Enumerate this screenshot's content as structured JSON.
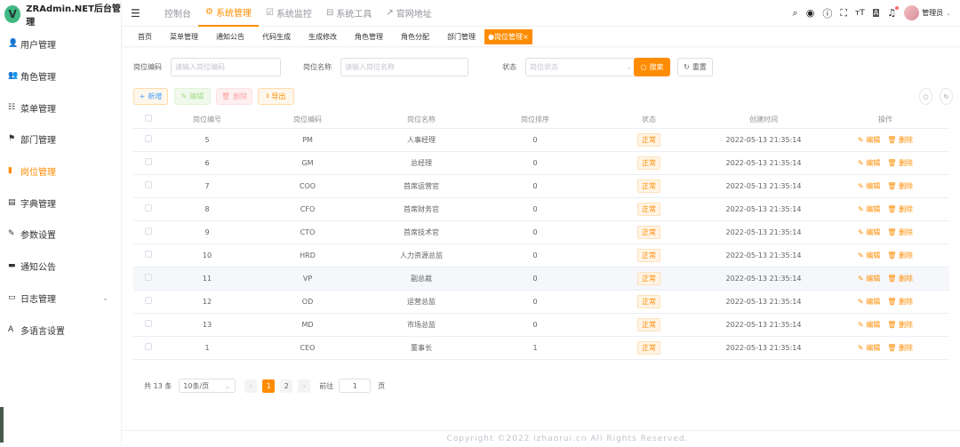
{
  "app": {
    "logo_letter": "V",
    "title": "ZRAdmin.NET后台管理"
  },
  "sidebar": {
    "items": [
      {
        "label": "用户管理",
        "icon": "user-icon"
      },
      {
        "label": "角色管理",
        "icon": "role-icon"
      },
      {
        "label": "菜单管理",
        "icon": "menu-icon"
      },
      {
        "label": "部门管理",
        "icon": "tree-icon"
      },
      {
        "label": "岗位管理",
        "icon": "post-icon",
        "active": true
      },
      {
        "label": "字典管理",
        "icon": "dict-icon"
      },
      {
        "label": "参数设置",
        "icon": "edit-icon"
      },
      {
        "label": "通知公告",
        "icon": "message-icon"
      },
      {
        "label": "日志管理",
        "icon": "log-icon",
        "expandable": true
      },
      {
        "label": "多语言设置",
        "icon": "language-icon"
      }
    ]
  },
  "topnav": {
    "items": [
      {
        "label": "控制台"
      },
      {
        "label": "系统管理",
        "active": true
      },
      {
        "label": "系统监控"
      },
      {
        "label": "系统工具"
      },
      {
        "label": "官网地址"
      }
    ]
  },
  "header": {
    "user": "管理员"
  },
  "tags": [
    "首页",
    "菜单管理",
    "通知公告",
    "代码生成",
    "生成修改",
    "角色管理",
    "角色分配",
    "部门管理"
  ],
  "active_tag": "岗位管理",
  "search": {
    "code_label": "岗位编码",
    "code_placeholder": "请输入岗位编码",
    "name_label": "岗位名称",
    "name_placeholder": "请输入岗位名称",
    "status_label": "状态",
    "status_placeholder": "岗位状态",
    "search_btn": "搜索",
    "reset_btn": "重置"
  },
  "toolbar": {
    "add": "新增",
    "edit": "编辑",
    "delete": "删除",
    "export": "导出"
  },
  "table": {
    "headers": [
      "岗位编号",
      "岗位编码",
      "岗位名称",
      "岗位排序",
      "状态",
      "创建时间",
      "操作"
    ],
    "edit": "编辑",
    "delete": "删除",
    "rows": [
      [
        "5",
        "PM",
        "人事经理",
        "0",
        "正常",
        "2022-05-13 21:35:14"
      ],
      [
        "6",
        "GM",
        "总经理",
        "0",
        "正常",
        "2022-05-13 21:35:14"
      ],
      [
        "7",
        "COO",
        "首席运营官",
        "0",
        "正常",
        "2022-05-13 21:35:14"
      ],
      [
        "8",
        "CFO",
        "首席财务官",
        "0",
        "正常",
        "2022-05-13 21:35:14"
      ],
      [
        "9",
        "CTO",
        "首席技术官",
        "0",
        "正常",
        "2022-05-13 21:35:14"
      ],
      [
        "10",
        "HRD",
        "人力资源总监",
        "0",
        "正常",
        "2022-05-13 21:35:14"
      ],
      [
        "11",
        "VP",
        "副总裁",
        "0",
        "正常",
        "2022-05-13 21:35:14"
      ],
      [
        "12",
        "OD",
        "运营总监",
        "0",
        "正常",
        "2022-05-13 21:35:14"
      ],
      [
        "13",
        "MD",
        "市场总监",
        "0",
        "正常",
        "2022-05-13 21:35:14"
      ],
      [
        "1",
        "CEO",
        "董事长",
        "1",
        "正常",
        "2022-05-13 21:35:14"
      ]
    ],
    "highlight_row": 6
  },
  "pagination": {
    "total": "共 13 条",
    "page_size": "10条/页",
    "pages": [
      "1",
      "2"
    ],
    "current": "1",
    "goto_label": "前往",
    "goto_value": "1",
    "page_suffix": "页"
  },
  "footer": "Copyright ©2022 izhaorui.cn All Rights Reserved.",
  "colors": {
    "accent": "#ff8c00"
  }
}
